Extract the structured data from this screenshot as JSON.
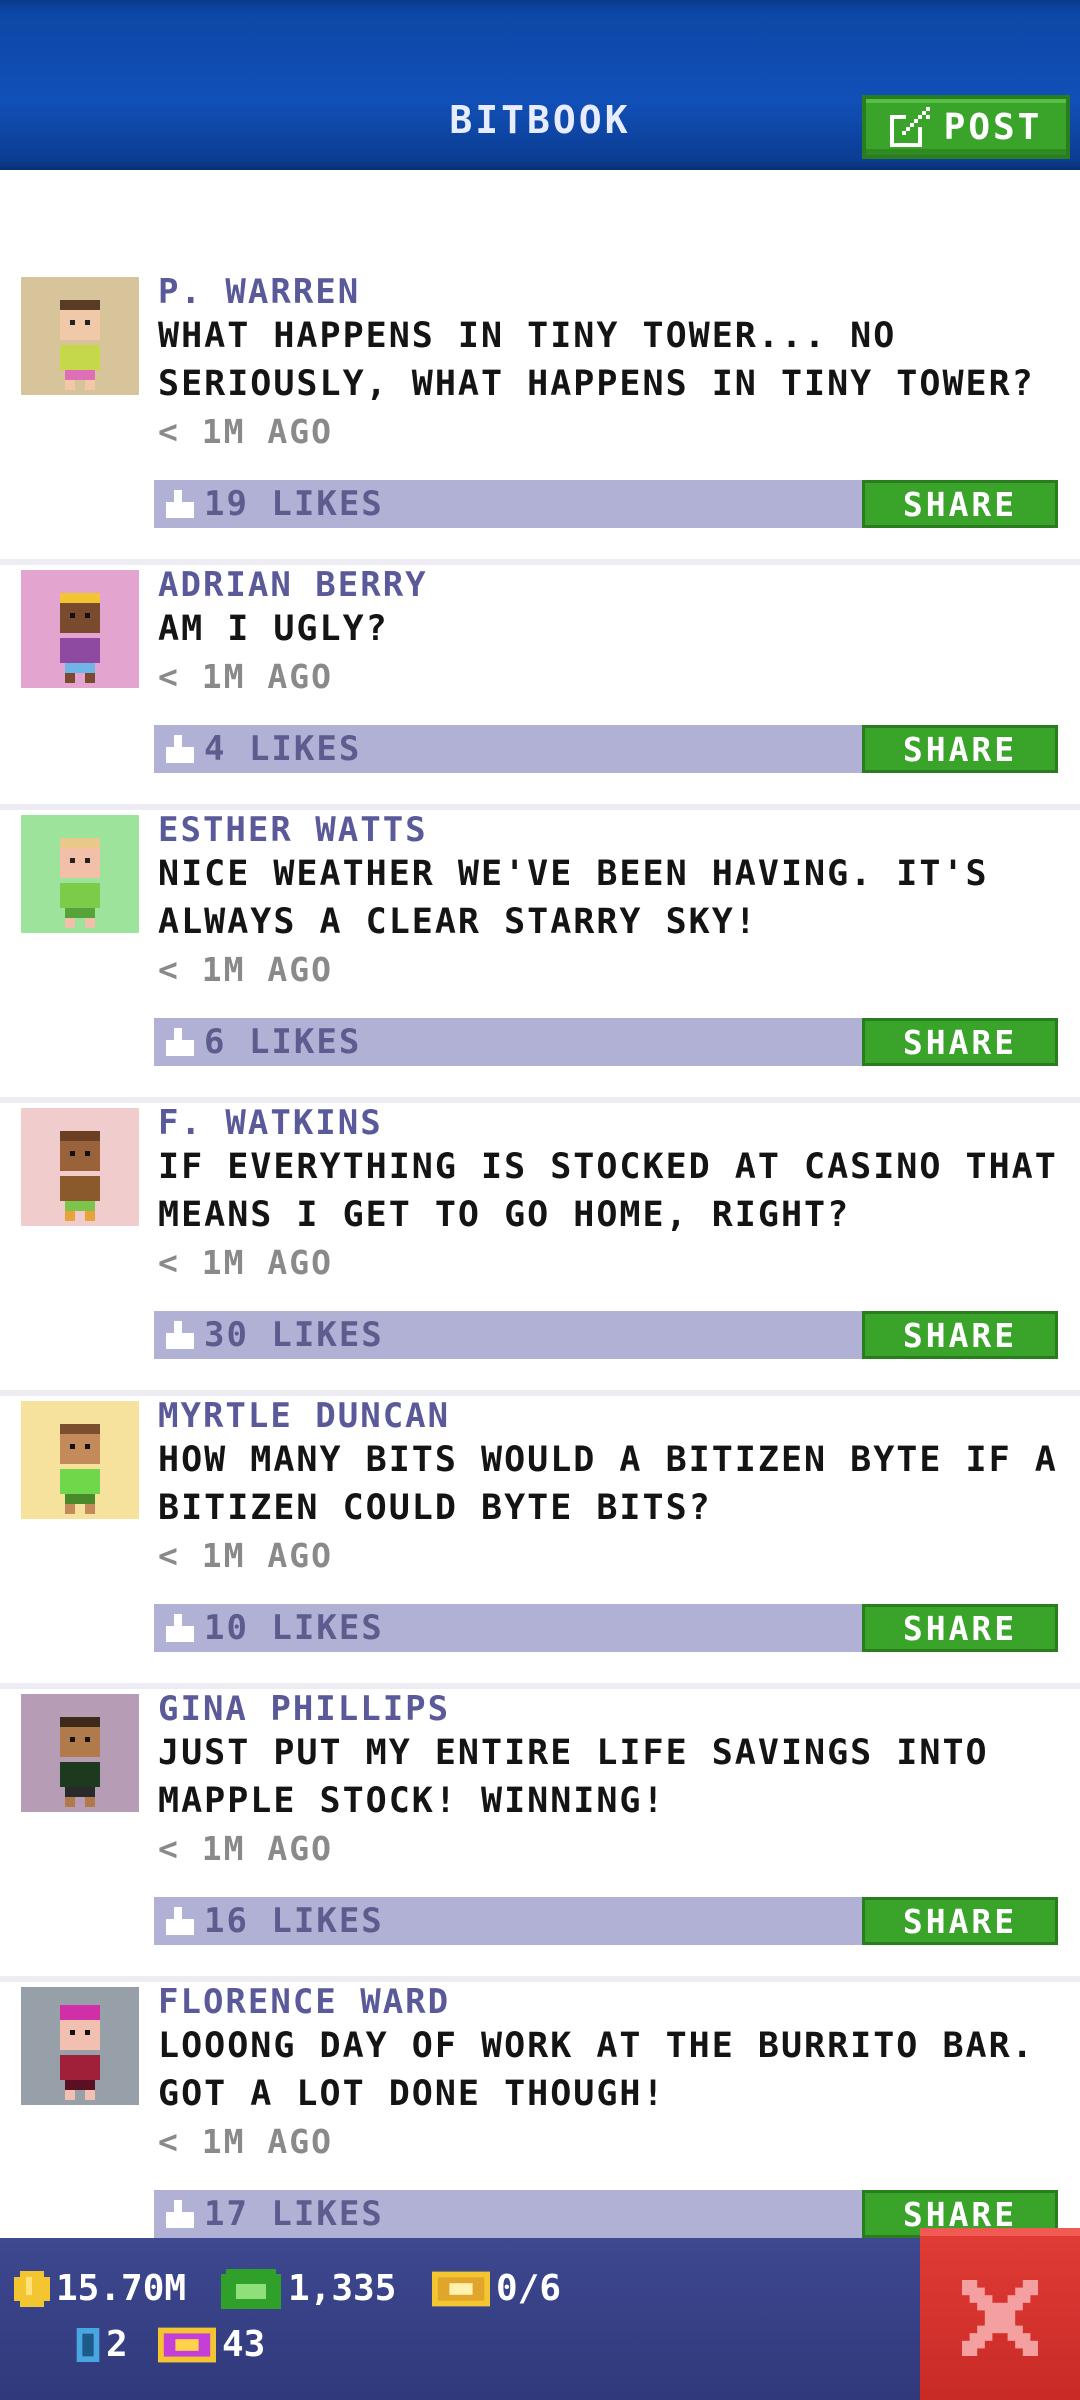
{
  "header": {
    "title": "BITBOOK",
    "post_label": "POST"
  },
  "posts": [
    {
      "author": "P. WARREN",
      "message": "WHAT HAPPENS IN TINY TOWER... NO SERIOUSLY, WHAT HAPPENS IN TINY TOWER?",
      "time": "< 1M AGO",
      "likes": "19 LIKES",
      "share": "SHARE",
      "avatar_bg": "#d8c49b"
    },
    {
      "author": "ADRIAN BERRY",
      "message": "AM I UGLY?",
      "time": "< 1M AGO",
      "likes": "4 LIKES",
      "share": "SHARE",
      "avatar_bg": "#e3a4d0"
    },
    {
      "author": "ESTHER WATTS",
      "message": "NICE WEATHER WE'VE BEEN HAVING. IT'S ALWAYS A CLEAR STARRY SKY!",
      "time": "< 1M AGO",
      "likes": "6 LIKES",
      "share": "SHARE",
      "avatar_bg": "#9ee39b"
    },
    {
      "author": "F. WATKINS",
      "message": "IF EVERYTHING IS STOCKED AT CASINO THAT MEANS I GET TO GO HOME, RIGHT?",
      "time": "< 1M AGO",
      "likes": "30 LIKES",
      "share": "SHARE",
      "avatar_bg": "#f1cccc"
    },
    {
      "author": "MYRTLE DUNCAN",
      "message": "HOW MANY BITS WOULD A BITIZEN BYTE IF A BITIZEN COULD BYTE BITS?",
      "time": "< 1M AGO",
      "likes": "10 LIKES",
      "share": "SHARE",
      "avatar_bg": "#f7e29d"
    },
    {
      "author": "GINA PHILLIPS",
      "message": "JUST PUT MY ENTIRE LIFE SAVINGS INTO MAPPLE STOCK! WINNING!",
      "time": "< 1M AGO",
      "likes": "16 LIKES",
      "share": "SHARE",
      "avatar_bg": "#b79cb5"
    },
    {
      "author": "FLORENCE WARD",
      "message": "LOOONG DAY OF WORK AT THE BURRITO BAR. GOT A LOT DONE THOUGH!",
      "time": "< 1M AGO",
      "likes": "17 LIKES",
      "share": "SHARE",
      "avatar_bg": "#97a0a8"
    }
  ],
  "status": {
    "coins": "15.70M",
    "bux": "1,335",
    "vip": "0/6",
    "elevators": "2",
    "tickets": "43"
  },
  "colors": {
    "header_blue": "#0d47a6",
    "share_green": "#3aa32a",
    "like_bar": "#b1b1d6",
    "close_red": "#d5322d"
  }
}
